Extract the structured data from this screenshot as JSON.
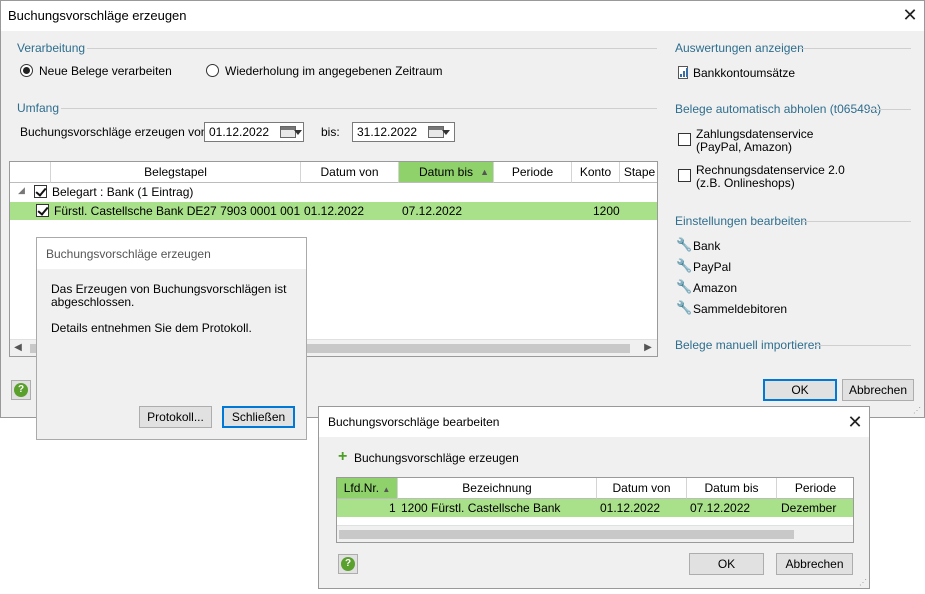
{
  "main": {
    "title": "Buchungsvorschläge erzeugen",
    "close_glyph": "✕",
    "verarbeitung": {
      "label": "Verarbeitung",
      "option1": "Neue Belege verarbeiten",
      "option2": "Wiederholung im angegebenen Zeitraum"
    },
    "umfang": {
      "label": "Umfang",
      "from_label": "Buchungsvorschläge erzeugen von:",
      "from_value": "01.12.2022",
      "to_label": "bis:",
      "to_value": "31.12.2022"
    },
    "grid": {
      "columns": [
        "Belegstapel",
        "Datum von",
        "Datum bis",
        "Periode",
        "Konto",
        "Stape"
      ],
      "group_row": "Belegart : Bank (1 Eintrag)",
      "row": {
        "belegstapel": "Fürstl. Castellsche Bank DE27 7903 0001 0012...",
        "datum_von": "01.12.2022",
        "datum_bis": "07.12.2022",
        "konto": "1200"
      }
    },
    "right": {
      "auswertungen_label": "Auswertungen anzeigen",
      "bankkonto": "Bankkontoumsätze",
      "belege_label": "Belege automatisch abholen (t06549a)",
      "zahlungs_line1": "Zahlungsdatenservice",
      "zahlungs_line2": "(PayPal, Amazon)",
      "rechnungs_line1": "Rechnungsdatenservice 2.0",
      "rechnungs_line2": "(z.B. Onlineshops)",
      "einstellungen_label": "Einstellungen bearbeiten",
      "items": [
        "Bank",
        "PayPal",
        "Amazon",
        "Sammeldebitoren"
      ],
      "manuell_label": "Belege manuell importieren"
    },
    "ok": "OK",
    "cancel": "Abbrechen"
  },
  "popup": {
    "title": "Buchungsvorschläge erzeugen",
    "line1": "Das Erzeugen von Buchungsvorschlägen ist",
    "line2": "abgeschlossen.",
    "line3": "Details entnehmen Sie dem Protokoll.",
    "protokoll": "Protokoll...",
    "schliessen": "Schließen"
  },
  "second": {
    "title": "Buchungsvorschläge bearbeiten",
    "close_glyph": "✕",
    "action": "Buchungsvorschläge erzeugen",
    "columns": [
      "Lfd.Nr.",
      "Bezeichnung",
      "Datum von",
      "Datum bis",
      "Periode"
    ],
    "row": {
      "nr": "1",
      "bezeichnung": "1200 Fürstl. Castellsche Bank",
      "datum_von": "01.12.2022",
      "datum_bis": "07.12.2022",
      "periode": "Dezember"
    },
    "ok": "OK",
    "cancel": "Abbrechen"
  },
  "colors": {
    "accent_green": "#8fd16b",
    "row_highlight": "#a9e08a",
    "group_label": "#2e6e8e",
    "default_button_border": "#0078d7"
  }
}
